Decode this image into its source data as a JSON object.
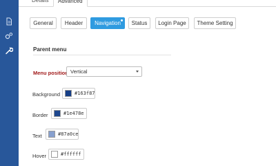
{
  "top_tabs": [
    "Details",
    "Advanced"
  ],
  "sub_tabs": [
    "General",
    "Header",
    "Navigation",
    "Status",
    "Login Page",
    "Theme Setting"
  ],
  "active_sub_tab": "Navigation",
  "section": {
    "title": "Parent menu"
  },
  "menu_position": {
    "label": "Menu position",
    "value": "Vertical"
  },
  "colors": {
    "background": {
      "label": "Background",
      "value": "#163f87"
    },
    "border": {
      "label": "Border",
      "value": "#1e478e"
    },
    "text": {
      "label": "Text",
      "value": "#87a0ce"
    },
    "hover": {
      "label": "Hover",
      "value": "#ffffff"
    }
  },
  "sidebar": {
    "bg": "#28579a",
    "icons": [
      "document-icon",
      "cogs-icon",
      "wrench-icon"
    ]
  },
  "accent": "#2f9be0"
}
